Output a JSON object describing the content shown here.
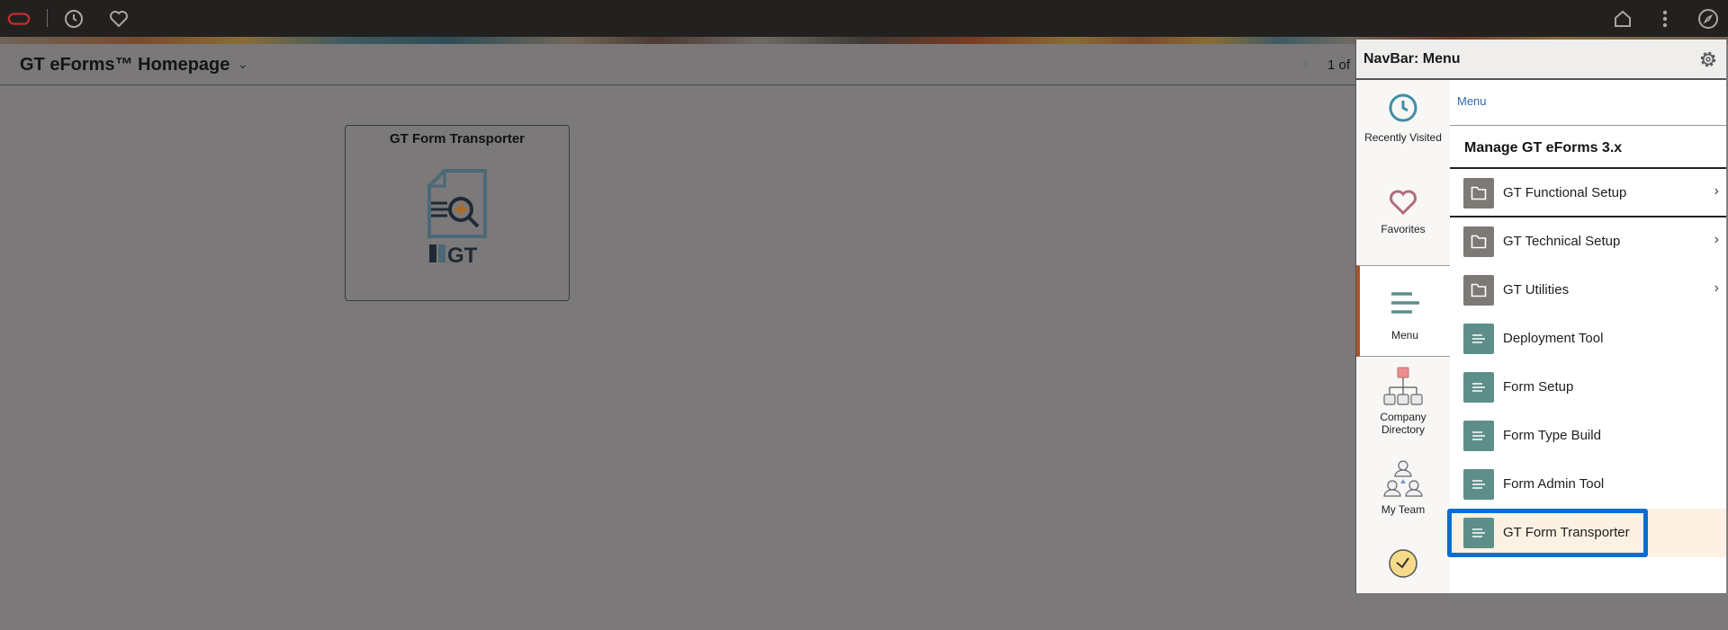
{
  "topbar": {
    "left_icons": [
      "oracle-logo-icon",
      "clock-icon",
      "heart-icon"
    ],
    "right_icons": [
      "home-icon",
      "more-vertical-icon",
      "compass-icon"
    ]
  },
  "page_header": {
    "title": "GT eForms™ Homepage",
    "title_chevron": "⌄",
    "pager_prev": "‹",
    "pager_text": "1 of"
  },
  "tiles": [
    {
      "title": "GT Form Transporter",
      "icon": "document-search-gt-icon"
    }
  ],
  "navbar": {
    "title": "NavBar: Menu",
    "settings_icon": "gear-icon",
    "left_items": [
      {
        "label": "Recently Visited",
        "icon": "clock-icon",
        "selected": false
      },
      {
        "label": "Favorites",
        "icon": "heart-icon",
        "selected": false
      },
      {
        "label": "Menu",
        "icon": "menu-lines-icon",
        "selected": true
      },
      {
        "label": "Company Directory",
        "icon": "org-chart-icon",
        "selected": false
      },
      {
        "label": "My Team",
        "icon": "team-icon",
        "selected": false
      },
      {
        "label": "",
        "icon": "time-clock-icon",
        "selected": false
      }
    ],
    "breadcrumb": "Menu",
    "group_title": "Manage GT eForms 3.x",
    "menu_items": [
      {
        "label": "GT Functional Setup",
        "type": "folder",
        "has_children": true,
        "selected": false
      },
      {
        "label": "GT Technical Setup",
        "type": "folder",
        "has_children": true,
        "selected": false
      },
      {
        "label": "GT Utilities",
        "type": "folder",
        "has_children": true,
        "selected": false
      },
      {
        "label": "Deployment Tool",
        "type": "page",
        "has_children": false,
        "selected": false
      },
      {
        "label": "Form Setup",
        "type": "page",
        "has_children": false,
        "selected": false
      },
      {
        "label": "Form Type Build",
        "type": "page",
        "has_children": false,
        "selected": false
      },
      {
        "label": "Form Admin Tool",
        "type": "page",
        "has_children": false,
        "selected": false
      },
      {
        "label": "GT Form Transporter",
        "type": "page",
        "has_children": false,
        "selected": true
      }
    ],
    "chevron": "›"
  },
  "colors": {
    "highlight_box": "#0a6ed1",
    "selected_row_bg": "#fcf1e3",
    "selected_nav_accent": "#a9532b",
    "folder_icon_bg": "#7d7974",
    "page_icon_bg": "#5e8e8a",
    "breadcrumb_link": "#2d6ab0"
  }
}
